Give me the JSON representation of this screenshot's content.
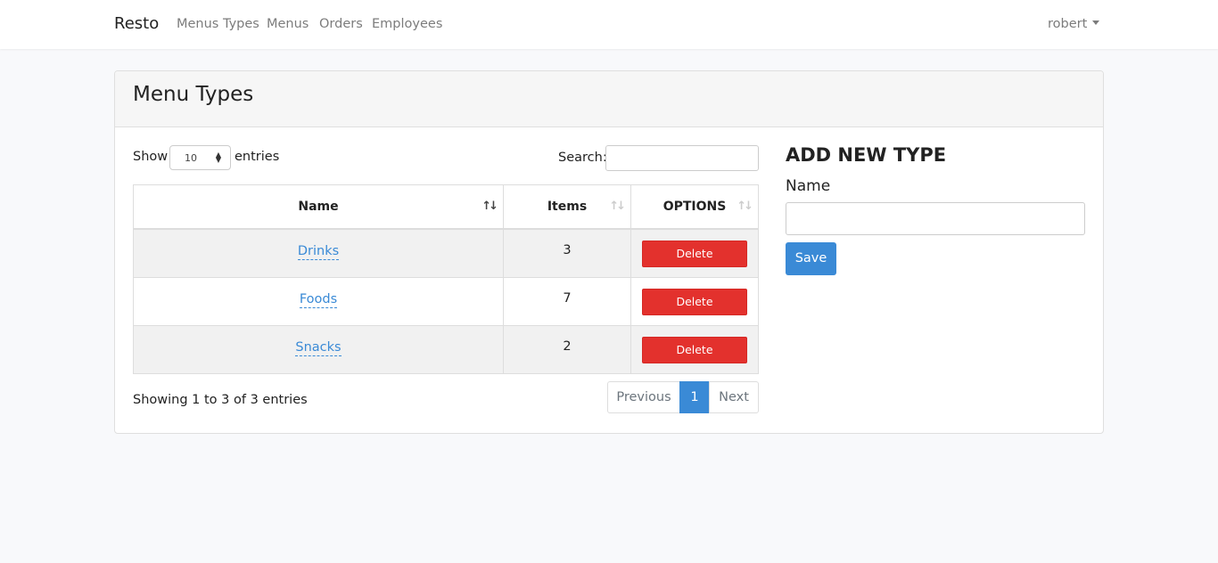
{
  "navbar": {
    "brand": "Resto",
    "links": [
      "Menus Types",
      "Menus",
      "Orders",
      "Employees"
    ],
    "user": "robert"
  },
  "card": {
    "title": "Menu Types",
    "length": {
      "show_label": "Show",
      "selected": "10",
      "entries_label": "entries"
    },
    "search_label": "Search:",
    "table": {
      "columns": [
        "Name",
        "Items",
        "OPTIONS"
      ],
      "rows": [
        {
          "name": "Drinks",
          "items": "3",
          "action": "Delete"
        },
        {
          "name": "Foods",
          "items": "7",
          "action": "Delete"
        },
        {
          "name": "Snacks",
          "items": "2",
          "action": "Delete"
        }
      ]
    },
    "info": "Showing 1 to 3 of 3 entries",
    "pagination": {
      "previous": "Previous",
      "current": "1",
      "next": "Next"
    }
  },
  "add_new": {
    "title": "ADD NEW TYPE",
    "name_label": "Name",
    "name_value": "",
    "save_label": "Save"
  },
  "colors": {
    "primary": "#3a8ad6",
    "danger": "#e3312d",
    "background": "#f8f9fb"
  },
  "icons": {
    "sort": "sort-arrows-icon",
    "dropdown": "caret-down-icon",
    "select": "select-arrows-icon"
  }
}
